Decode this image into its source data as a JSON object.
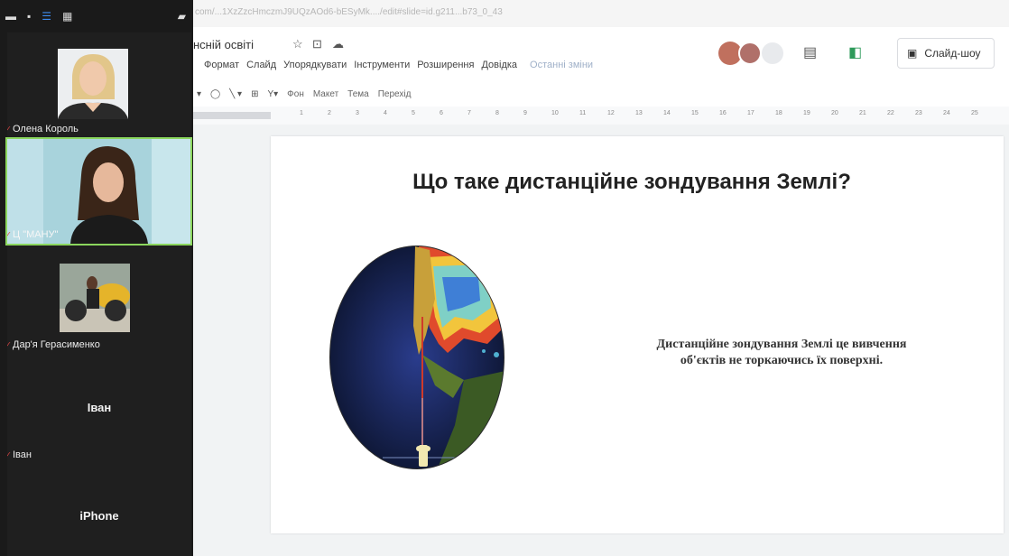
{
  "zoom": {
    "participants": [
      {
        "name": "Олена Король"
      },
      {
        "name": "Ц \"МАНУ\""
      },
      {
        "name": "Дар'я Герасименко"
      },
      {
        "name": "Іван",
        "center_label": "Іван"
      },
      {
        "center_label": "iPhone"
      }
    ],
    "colors": {
      "panel_bg": "#1a1a1a",
      "speaking_border": "#8bd65d",
      "toolbar_active": "#3d8cf0"
    }
  },
  "browser": {
    "url": "com/...1XzZzcHmczmJ9UQzAOd6-bESyMk..../edit#slide=id.g211...b73_0_43"
  },
  "doc": {
    "title": "нсній освіті",
    "menu": [
      "Формат",
      "Слайд",
      "Упорядкувати",
      "Інструменти",
      "Розширення",
      "Довідка"
    ],
    "last_edit": "Останні зміни",
    "slideshow_label": "Слайд-шоу"
  },
  "toolbar": {
    "items": [
      "Фон",
      "Макет",
      "Тема",
      "Перехід"
    ]
  },
  "ruler": {
    "numbers": [
      "1",
      "2",
      "3",
      "4",
      "5",
      "6",
      "7",
      "8",
      "9",
      "10",
      "11",
      "12",
      "13",
      "14",
      "15",
      "16",
      "17",
      "18",
      "19",
      "20",
      "21",
      "22",
      "23",
      "24",
      "25"
    ]
  },
  "slide": {
    "title": "Що таке дистанційне зондування Землі?",
    "text": "Дистанційне зондування Землі це вивчення об'єктів не торкаючись їх поверхні."
  }
}
